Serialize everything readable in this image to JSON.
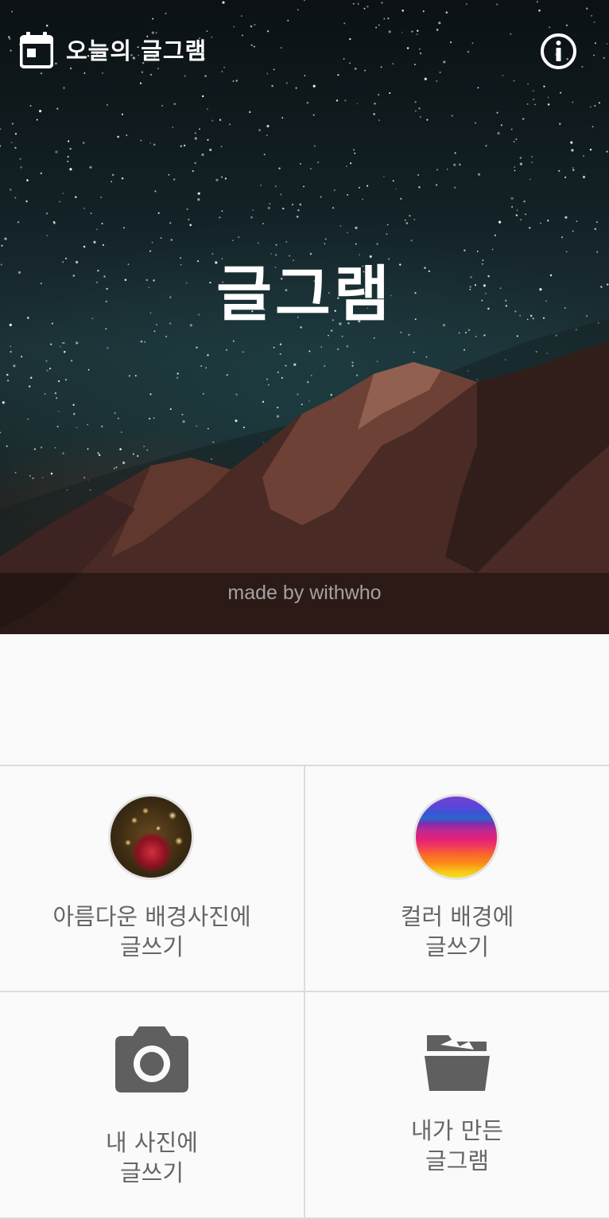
{
  "topbar": {
    "calendar_icon": "calendar-icon",
    "title": "오늘의 글그램",
    "info_icon": "info-icon"
  },
  "hero": {
    "title": "글그램",
    "credit": "made by withwho"
  },
  "menu": [
    {
      "line1": "아름다운 배경사진에",
      "line2": "글쓰기",
      "icon": "photo-thumbnail"
    },
    {
      "line1": "컬러 배경에",
      "line2": "글쓰기",
      "icon": "rainbow-thumbnail"
    },
    {
      "line1": "내 사진에",
      "line2": "글쓰기",
      "icon": "camera-icon"
    },
    {
      "line1": "내가 만든",
      "line2": "글그램",
      "icon": "folder-icon"
    }
  ],
  "colors": {
    "icon_gray": "#5f5f5f",
    "label_gray": "#666666",
    "divider": "#dcdcdc",
    "background": "#fafafa"
  }
}
